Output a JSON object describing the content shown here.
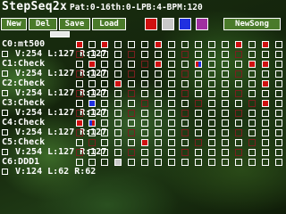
{
  "app_title": "StepSeq2x",
  "status": "Pat:0-16th:0-LPB:4-BPM:120",
  "toolbar": {
    "new_label": "New",
    "del_label": "Del",
    "save_label": "Save",
    "load_label": "Load",
    "newsong_label": "NewSong"
  },
  "colors": {
    "red": "#d01010",
    "gray": "#c8c8c8",
    "blue": "#2030e0",
    "purple": "#a030a0"
  },
  "channels": [
    {
      "name": "C0:mt500",
      "info": "V:254 L:127 R:127",
      "steps": [
        "red",
        "none",
        "red",
        "none",
        "none",
        "none",
        "red",
        "none",
        "none",
        "none",
        "none",
        "none",
        "red",
        "none",
        "red",
        "none"
      ]
    },
    {
      "name": "C1:Check",
      "info": "V:254 L:127 R:127",
      "steps": [
        "none",
        "red",
        "none",
        "none",
        "none",
        "none",
        "red",
        "none",
        "none",
        "rb",
        "none",
        "none",
        "none",
        "red",
        "red",
        "none"
      ]
    },
    {
      "name": "C2:Check",
      "info": "V:254 L:127 R:127",
      "steps": [
        "none",
        "none",
        "none",
        "red",
        "none",
        "none",
        "none",
        "none",
        "none",
        "none",
        "none",
        "none",
        "none",
        "none",
        "red",
        "none"
      ]
    },
    {
      "name": "C3:Check",
      "info": "V:254 L:127 R:127",
      "steps": [
        "none",
        "blue",
        "none",
        "none",
        "none",
        "none",
        "none",
        "none",
        "none",
        "none",
        "none",
        "none",
        "none",
        "none",
        "red",
        "none"
      ]
    },
    {
      "name": "C4:Check",
      "info": "V:254 L:127 R:127",
      "steps": [
        "red",
        "br",
        "none",
        "none",
        "none",
        "none",
        "none",
        "none",
        "none",
        "none",
        "none",
        "none",
        "none",
        "none",
        "none",
        "none"
      ]
    },
    {
      "name": "C5:Check",
      "info": "V:254 L:127 R:127",
      "steps": [
        "none",
        "none",
        "none",
        "none",
        "none",
        "red",
        "none",
        "none",
        "none",
        "none",
        "none",
        "none",
        "none",
        "none",
        "none",
        "none"
      ]
    },
    {
      "name": "C6:DDD1",
      "info": "V:124 L:62 R:62",
      "steps": [
        "none",
        "none",
        "none",
        "gray",
        "none",
        "none",
        "none",
        "none",
        "none",
        "none",
        "none",
        "none",
        "none",
        "none",
        "none",
        "none"
      ]
    }
  ]
}
